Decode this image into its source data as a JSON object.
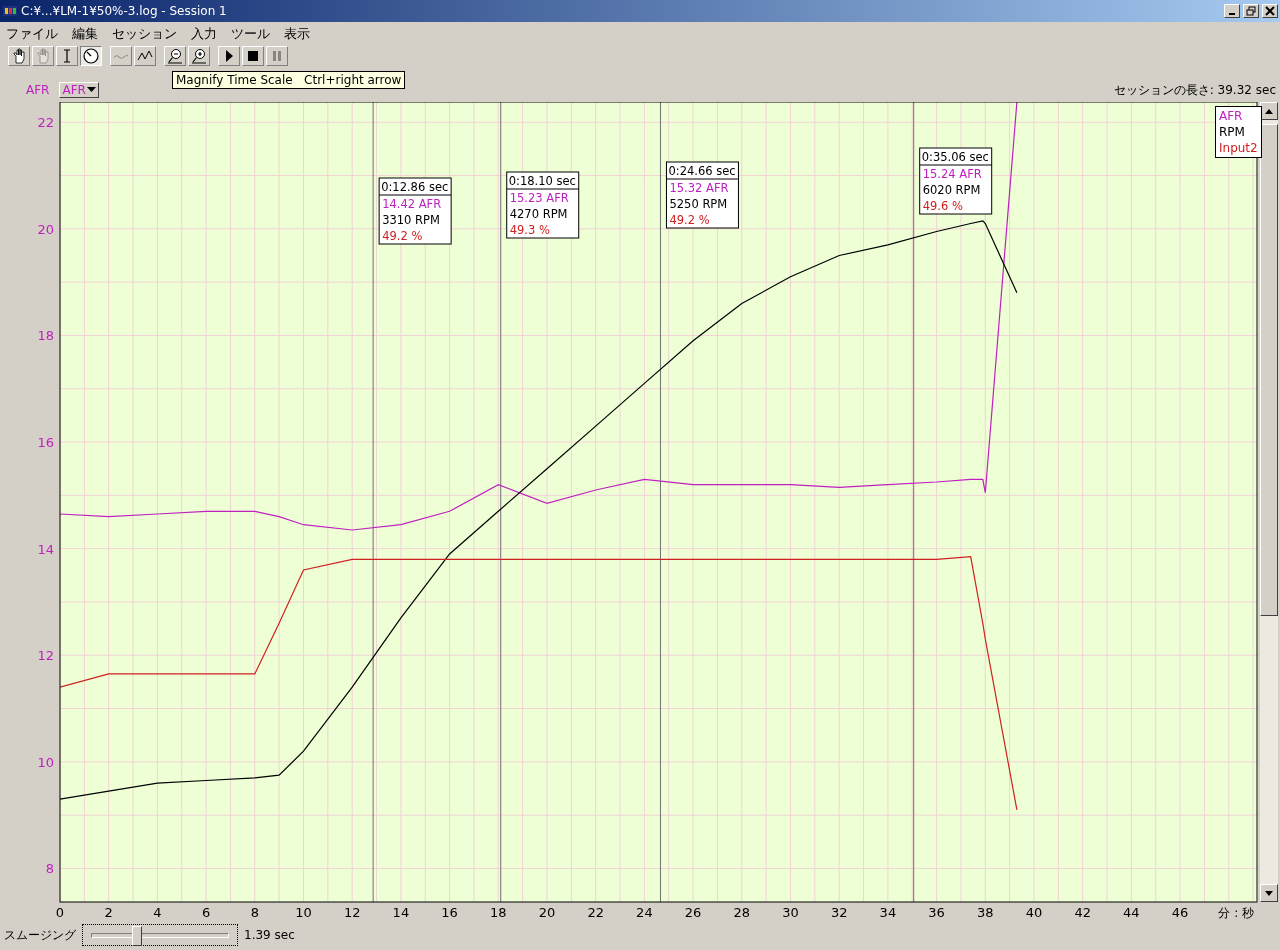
{
  "window": {
    "title": "C:¥...¥LM-1¥50%-3.log - Session 1"
  },
  "menu": [
    "ファイル",
    "編集",
    "セッション",
    "入力",
    "ツール",
    "表示"
  ],
  "toolbar": [
    [
      {
        "kind": "hand",
        "pressed": false,
        "disabled": false
      },
      {
        "kind": "hand",
        "pressed": false,
        "disabled": true
      },
      {
        "kind": "ibeam",
        "pressed": false,
        "disabled": false
      },
      {
        "kind": "gauge",
        "pressed": true,
        "disabled": false
      }
    ],
    [
      {
        "kind": "wave",
        "pressed": false,
        "disabled": true
      },
      {
        "kind": "zigzag",
        "pressed": false,
        "disabled": false
      }
    ],
    [
      {
        "kind": "zoomout",
        "pressed": false,
        "disabled": false
      },
      {
        "kind": "zoomin",
        "pressed": false,
        "disabled": false
      }
    ],
    [
      {
        "kind": "play",
        "pressed": false,
        "disabled": false
      },
      {
        "kind": "stop",
        "pressed": false,
        "disabled": false
      },
      {
        "kind": "pause",
        "pressed": false,
        "disabled": true
      }
    ]
  ],
  "tooltip": "Magnify Time Scale   Ctrl+right arrow",
  "axis_label": "AFR",
  "channel_select": {
    "value": "AFR"
  },
  "session_length": "セッションの長さ: 39.32 sec",
  "chart": {
    "chart_data": {
      "type": "line",
      "xlabel": "分 : 秒",
      "xlim": [
        0,
        49.2
      ],
      "ylim": [
        7.37,
        22.38
      ],
      "grid": true,
      "xticks": [
        0,
        2,
        4,
        6,
        8,
        10,
        12,
        14,
        16,
        18,
        20,
        22,
        24,
        26,
        28,
        30,
        32,
        34,
        36,
        38,
        40,
        42,
        44,
        46
      ],
      "yticks": [
        8,
        10,
        12,
        14,
        16,
        18,
        20,
        22
      ],
      "x": [
        0,
        2,
        4,
        6,
        8,
        9,
        10,
        12,
        14,
        16,
        18,
        20,
        22,
        24,
        26,
        28,
        30,
        32,
        34,
        36,
        37.4,
        37.9,
        38,
        39.3
      ],
      "series": [
        {
          "name": "AFR",
          "color": "#c020c0",
          "values": [
            14.65,
            14.6,
            14.65,
            14.7,
            14.7,
            14.6,
            14.45,
            14.35,
            14.45,
            14.7,
            15.2,
            14.85,
            15.1,
            15.3,
            15.2,
            15.2,
            15.2,
            15.15,
            15.2,
            15.25,
            15.3,
            15.3,
            15.05,
            22.38
          ]
        },
        {
          "name": "RPM",
          "color": "#000000",
          "values": [
            9.3,
            9.45,
            9.6,
            9.65,
            9.7,
            9.75,
            10.2,
            11.4,
            12.7,
            13.9,
            14.7,
            15.5,
            16.3,
            17.1,
            17.9,
            18.6,
            19.1,
            19.5,
            19.7,
            19.95,
            20.1,
            20.15,
            20.1,
            18.8
          ]
        },
        {
          "name": "Input2",
          "color": "#d02020",
          "values": [
            11.4,
            11.65,
            11.65,
            11.65,
            11.65,
            12.6,
            13.6,
            13.8,
            13.8,
            13.8,
            13.8,
            13.8,
            13.8,
            13.8,
            13.8,
            13.8,
            13.8,
            13.8,
            13.8,
            13.8,
            13.85,
            12.6,
            12.3,
            9.1
          ]
        }
      ],
      "annotations": [
        "0:12.86 sec",
        "0:18.10 sec",
        "0:24.66 sec",
        "0:35.06 sec"
      ],
      "ref_lines": [
        {
          "axis": "x",
          "value": 12.86
        },
        {
          "axis": "x",
          "value": 18.1
        },
        {
          "axis": "x",
          "value": 24.66
        },
        {
          "axis": "x",
          "value": 35.06
        }
      ]
    },
    "cursor_readouts": [
      {
        "values": [
          "14.42 AFR",
          "3310 RPM",
          "49.2 %"
        ]
      },
      {
        "values": [
          "15.23 AFR",
          "4270 RPM",
          "49.3 %"
        ]
      },
      {
        "values": [
          "15.32 AFR",
          "5250 RPM",
          "49.2 %"
        ]
      },
      {
        "values": [
          "15.24 AFR",
          "6020 RPM",
          "49.6 %"
        ]
      }
    ]
  },
  "smoothing": {
    "label": "スムージング",
    "level": 0.32,
    "reading": "1.39 sec"
  }
}
